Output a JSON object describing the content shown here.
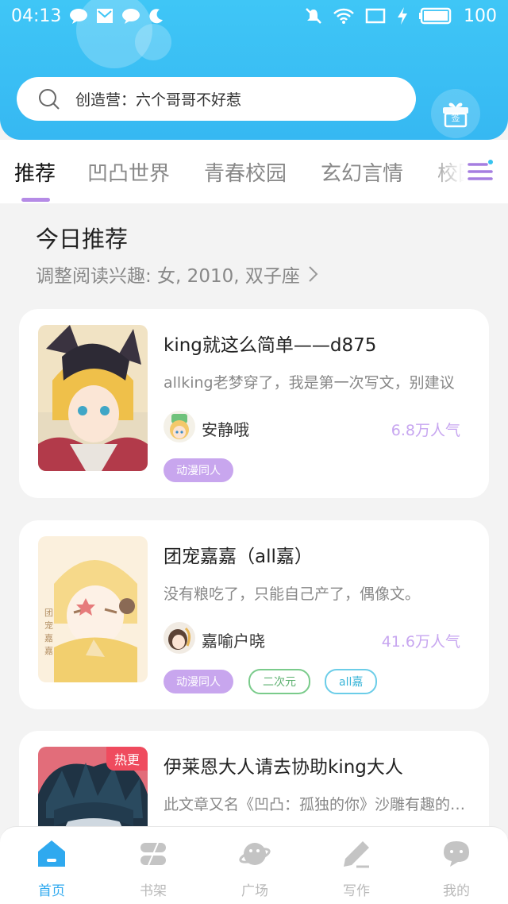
{
  "status_bar": {
    "time": "04:13",
    "battery": "100",
    "icons": [
      "chat-bubble-icon",
      "mail-icon",
      "chat-bubble-icon",
      "moon-icon",
      "mute-icon",
      "wifi-icon",
      "screen-icon",
      "charging-icon",
      "battery-icon"
    ]
  },
  "search": {
    "icon": "search-icon",
    "text": "创造营：六个哥哥不好惹"
  },
  "gift": {
    "icon": "gift-icon",
    "label": "签"
  },
  "tabs": [
    {
      "label": "推荐",
      "active": true
    },
    {
      "label": "凹凸世界",
      "active": false
    },
    {
      "label": "青春校园",
      "active": false
    },
    {
      "label": "玄幻言情",
      "active": false
    },
    {
      "label": "校园",
      "active": false
    }
  ],
  "tab_menu_icon": "menu-icon",
  "section": {
    "title": "今日推荐",
    "subtitle": "调整阅读兴趣: 女, 2010, 双子座"
  },
  "books": [
    {
      "title": "king就这么简单——d875",
      "desc": "allking老梦穿了，我是第一次写文，别建议",
      "author": "安静哦",
      "popularity": "6.8万人气",
      "tags": [
        {
          "label": "动漫同人",
          "style": "purple"
        }
      ]
    },
    {
      "title": "团宠嘉嘉（all嘉）",
      "desc": "没有粮吃了，只能自己产了，偶像文。",
      "author": "嘉喻户晓",
      "popularity": "41.6万人气",
      "tags": [
        {
          "label": "动漫同人",
          "style": "purple"
        },
        {
          "label": "二次元",
          "style": "green"
        },
        {
          "label": "all嘉",
          "style": "blue"
        }
      ]
    },
    {
      "title": "伊莱恩大人请去协助king大人",
      "desc": "此文章又名《凹凸：孤独的你》沙雕有趣的故事",
      "badge": "热更"
    }
  ],
  "bottom_nav": [
    {
      "label": "首页",
      "icon": "home-icon",
      "active": true
    },
    {
      "label": "书架",
      "icon": "bookshelf-icon",
      "active": false
    },
    {
      "label": "广场",
      "icon": "planet-icon",
      "active": false
    },
    {
      "label": "写作",
      "icon": "pen-icon",
      "active": false
    },
    {
      "label": "我的",
      "icon": "profile-chat-icon",
      "active": false
    }
  ],
  "colors": {
    "header": "#3fc6f6",
    "accent_purple": "#b58be6",
    "popularity": "#c7a6f0",
    "nav_active": "#2fa9ef",
    "hot_badge": "#ef4b5e"
  }
}
